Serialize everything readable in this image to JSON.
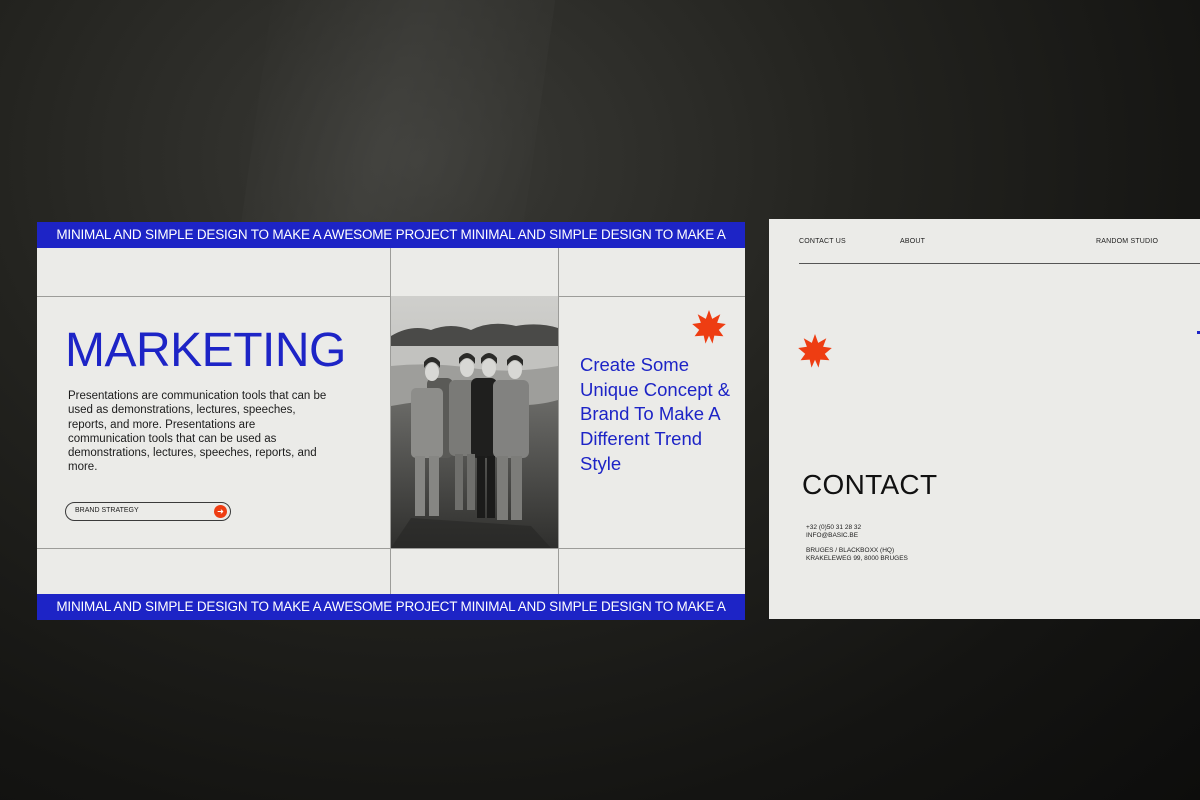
{
  "slide1": {
    "ticker_top": "MINIMAL AND SIMPLE DESIGN TO MAKE A AWESOME PROJECT MINIMAL AND SIMPLE DESIGN TO MAKE A",
    "ticker_bottom": "MINIMAL AND SIMPLE DESIGN TO MAKE A AWESOME PROJECT MINIMAL AND SIMPLE DESIGN TO MAKE A",
    "title": "MARKETING",
    "description": "Presentations are communication tools that can be used as demonstrations, lectures, speeches, reports, and more. Presentations are communication tools that can be used as demonstrations, lectures, speeches, reports, and more.",
    "button_label": "BRAND STRATEGY",
    "button_icon": "arrow-right-icon",
    "tagline": "Create Some Unique Concept & Brand To Make A Different Trend Style",
    "photo_icon": "group-photo",
    "star_icon": "starburst-icon"
  },
  "slide2": {
    "nav": {
      "contact": "CONTACT US",
      "about": "ABOUT",
      "studio": "RANDOM STUDIO"
    },
    "title": "CONTACT",
    "phone": "+32 (0)50 31 28 32",
    "email": "INFO@BASIC.BE",
    "address_line1": "BRUGES / BLACKBOXX (HQ)",
    "address_line2": "KRAKELEWEG 99, 8000 BRUGES",
    "star_icon": "starburst-icon"
  },
  "colors": {
    "brand_blue": "#1d24c6",
    "accent_orange": "#ee3d12",
    "paper": "#ebebe8",
    "background": "#161614"
  }
}
